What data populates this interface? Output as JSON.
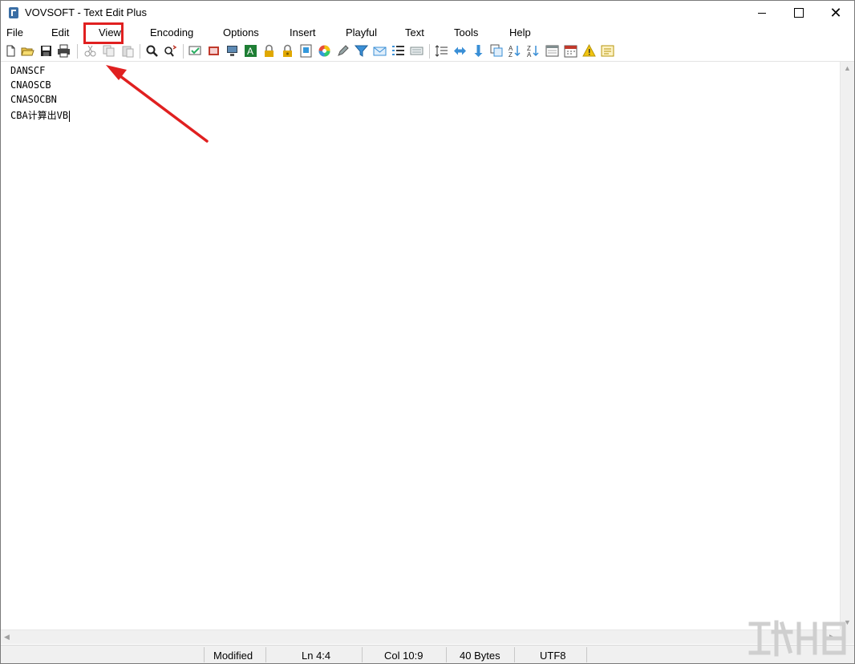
{
  "window": {
    "title": "VOVSOFT - Text Edit Plus"
  },
  "menu": [
    "File",
    "Edit",
    "View",
    "Encoding",
    "Options",
    "Insert",
    "Playful",
    "Text",
    "Tools",
    "Help"
  ],
  "toolbar_icons": [
    "new-file-icon",
    "open-folder-icon",
    "save-icon",
    "print-icon",
    "cut-icon",
    "copy-icon",
    "paste-icon",
    "find-icon",
    "replace-icon",
    "spellcheck-icon",
    "book-icon",
    "monitor-icon",
    "font-icon",
    "lock-icon",
    "unlock-icon",
    "info-icon",
    "color-wheel-icon",
    "pen-icon",
    "filter-icon",
    "mail-icon",
    "list-icon",
    "keyboard-icon",
    "line-spacing-icon",
    "swap-horizontal-icon",
    "swap-vertical-icon",
    "duplicate-icon",
    "sort-az-icon",
    "sort-za-icon",
    "window-icon",
    "calendar-icon",
    "warning-icon",
    "note-icon"
  ],
  "editor": {
    "lines": [
      "DANSCF",
      "CNAOSCB",
      "CNASOCBN",
      "CBA计算出VB"
    ]
  },
  "status": {
    "modified": "Modified",
    "line": "Ln 4:4",
    "col": "Col 10:9",
    "size": "40 Bytes",
    "encoding": "UTF8"
  },
  "colors": {
    "annotation": "#e02020"
  }
}
